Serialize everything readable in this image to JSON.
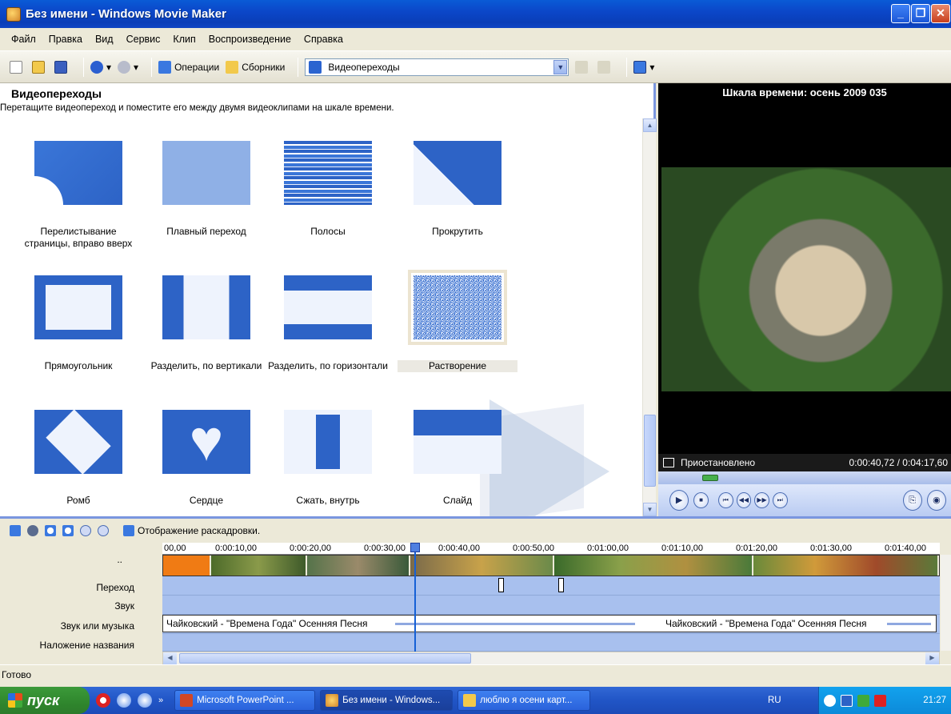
{
  "window": {
    "title": "Без имени - Windows Movie Maker"
  },
  "menu": [
    "Файл",
    "Правка",
    "Вид",
    "Сервис",
    "Клип",
    "Воспроизведение",
    "Справка"
  ],
  "toolbar": {
    "operations": "Операции",
    "collections": "Сборники",
    "combo_value": "Видеопереходы"
  },
  "left_panel": {
    "title": "Видеопереходы",
    "subtitle": "Перетащите видеопереход и поместите его между двумя видеоклипами на шкале времени.",
    "items": [
      {
        "label": "Перелистывание страницы, вправо вверх",
        "icon": "page-curl-icon"
      },
      {
        "label": "Плавный переход",
        "icon": "fade-icon"
      },
      {
        "label": "Полосы",
        "icon": "bars-icon"
      },
      {
        "label": "Прокрутить",
        "icon": "roll-icon"
      },
      {
        "label": "Прямоугольник",
        "icon": "rectangle-icon"
      },
      {
        "label": "Разделить, по вертикали",
        "icon": "split-vertical-icon"
      },
      {
        "label": "Разделить, по горизонтали",
        "icon": "split-horizontal-icon"
      },
      {
        "label": "Растворение",
        "icon": "dissolve-icon",
        "selected": true
      },
      {
        "label": "Ромб",
        "icon": "diamond-icon"
      },
      {
        "label": "Сердце",
        "icon": "heart-icon"
      },
      {
        "label": "Сжать, внутрь",
        "icon": "shrink-in-icon"
      },
      {
        "label": "Слайд",
        "icon": "slide-icon"
      }
    ]
  },
  "preview": {
    "title": "Шкала времени: осень 2009 035",
    "status": "Приостановлено",
    "time": "0:00:40,72 / 0:04:17,60",
    "position_fraction": 0.158
  },
  "timeline": {
    "storyboard_label": "Отображение раскадровки.",
    "tracks": [
      "..",
      "Переход",
      "Звук",
      "Звук или музыка",
      "Наложение названия"
    ],
    "ruler": [
      "00,00",
      "0:00:10,00",
      "0:00:20,00",
      "0:00:30,00",
      "0:00:40,00",
      "0:00:50,00",
      "0:01:00,00",
      "0:01:10,00",
      "0:01:20,00",
      "0:01:30,00",
      "0:01:40,00"
    ],
    "audio_clip_1": "Чайковский - \"Времена Года\" Осенняя Песня",
    "audio_clip_2": "Чайковский - \"Времена Года\" Осенняя Песня"
  },
  "status_bar": {
    "text": "Готово"
  },
  "taskbar": {
    "start": "пуск",
    "tasks": [
      "Microsoft PowerPoint ...",
      "Без имени - Windows...",
      "люблю я осени карт..."
    ],
    "lang": "RU",
    "clock": "21:27"
  },
  "colors": {
    "accent": "#4a7bd6",
    "titlebar": "#0b47c9",
    "timeline_track": "#a8c0ee"
  }
}
